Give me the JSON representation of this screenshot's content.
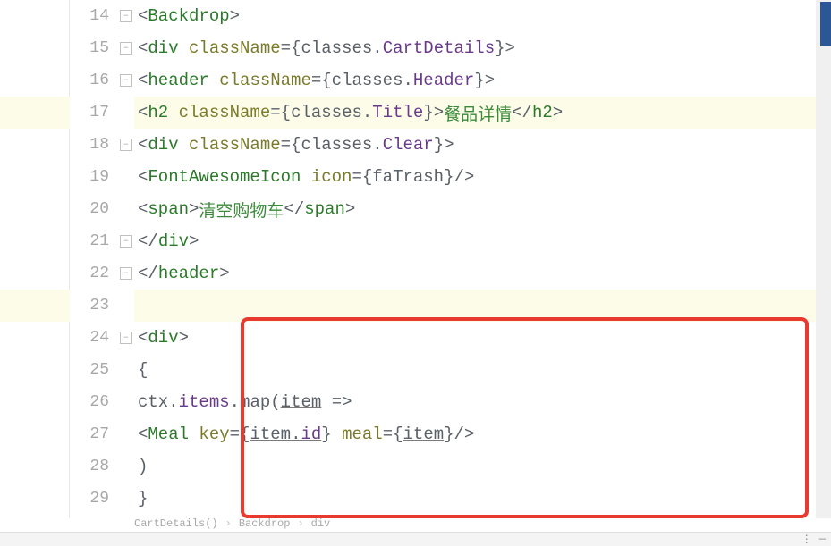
{
  "lines": [
    {
      "num": "14",
      "indent": 1,
      "tokens": [
        [
          "tag-bracket",
          "<"
        ],
        [
          "tag-name",
          "Backdrop"
        ],
        [
          "tag-bracket",
          ">"
        ]
      ],
      "fold": true
    },
    {
      "num": "15",
      "indent": 2,
      "tokens": [
        [
          "tag-bracket",
          "<"
        ],
        [
          "tag-name",
          "div "
        ],
        [
          "attr-name",
          "className"
        ],
        [
          "attr-eq",
          "="
        ],
        [
          "brace",
          "{"
        ],
        [
          "ident",
          "classes"
        ],
        [
          "op",
          "."
        ],
        [
          "prop",
          "CartDetails"
        ],
        [
          "brace",
          "}"
        ],
        [
          "tag-bracket",
          ">"
        ]
      ],
      "fold": true
    },
    {
      "num": "16",
      "indent": 3,
      "tokens": [
        [
          "tag-bracket",
          "<"
        ],
        [
          "tag-name",
          "header "
        ],
        [
          "attr-name",
          "className"
        ],
        [
          "attr-eq",
          "="
        ],
        [
          "brace",
          "{"
        ],
        [
          "ident",
          "classes"
        ],
        [
          "op",
          "."
        ],
        [
          "prop",
          "Header"
        ],
        [
          "brace",
          "}"
        ],
        [
          "tag-bracket",
          ">"
        ]
      ],
      "fold": true
    },
    {
      "num": "17",
      "indent": 4,
      "tokens": [
        [
          "tag-bracket",
          "<"
        ],
        [
          "tag-name",
          "h2 "
        ],
        [
          "attr-name",
          "className"
        ],
        [
          "attr-eq",
          "="
        ],
        [
          "brace",
          "{"
        ],
        [
          "ident",
          "classes"
        ],
        [
          "op",
          "."
        ],
        [
          "prop",
          "Title"
        ],
        [
          "brace",
          "}"
        ],
        [
          "tag-bracket",
          ">"
        ],
        [
          "text",
          "餐品详情"
        ],
        [
          "tag-bracket",
          "</"
        ],
        [
          "tag-name",
          "h2"
        ],
        [
          "tag-bracket",
          ">"
        ]
      ],
      "hl": true
    },
    {
      "num": "18",
      "indent": 4,
      "tokens": [
        [
          "tag-bracket",
          "<"
        ],
        [
          "tag-name",
          "div "
        ],
        [
          "attr-name",
          "className"
        ],
        [
          "attr-eq",
          "="
        ],
        [
          "brace",
          "{"
        ],
        [
          "ident",
          "classes"
        ],
        [
          "op",
          "."
        ],
        [
          "prop",
          "Clear"
        ],
        [
          "brace",
          "}"
        ],
        [
          "tag-bracket",
          ">"
        ]
      ],
      "fold": true
    },
    {
      "num": "19",
      "indent": 5,
      "tokens": [
        [
          "tag-bracket",
          "<"
        ],
        [
          "tag-name",
          "FontAwesomeIcon "
        ],
        [
          "attr-name",
          "icon"
        ],
        [
          "attr-eq",
          "="
        ],
        [
          "brace",
          "{"
        ],
        [
          "ident",
          "faTrash"
        ],
        [
          "brace",
          "}"
        ],
        [
          "tag-bracket",
          "/>"
        ]
      ]
    },
    {
      "num": "20",
      "indent": 5,
      "tokens": [
        [
          "tag-bracket",
          "<"
        ],
        [
          "tag-name",
          "span"
        ],
        [
          "tag-bracket",
          ">"
        ],
        [
          "text",
          "清空购物车"
        ],
        [
          "tag-bracket",
          "</"
        ],
        [
          "tag-name",
          "span"
        ],
        [
          "tag-bracket",
          ">"
        ]
      ]
    },
    {
      "num": "21",
      "indent": 4,
      "tokens": [
        [
          "tag-bracket",
          "</"
        ],
        [
          "tag-name",
          "div"
        ],
        [
          "tag-bracket",
          ">"
        ]
      ],
      "foldclose": true
    },
    {
      "num": "22",
      "indent": 3,
      "tokens": [
        [
          "tag-bracket",
          "</"
        ],
        [
          "tag-name",
          "header"
        ],
        [
          "tag-bracket",
          ">"
        ]
      ],
      "foldclose": true
    },
    {
      "num": "23",
      "indent": 0,
      "tokens": [],
      "hl": true
    },
    {
      "num": "24",
      "indent": 3,
      "tokens": [
        [
          "tag-bracket",
          "<"
        ],
        [
          "tag-name",
          "div"
        ],
        [
          "tag-bracket",
          ">"
        ]
      ],
      "fold": true
    },
    {
      "num": "25",
      "indent": 4,
      "tokens": [
        [
          "brace",
          "{"
        ]
      ]
    },
    {
      "num": "26",
      "indent": 5,
      "tokens": [
        [
          "ident",
          "ctx"
        ],
        [
          "op",
          "."
        ],
        [
          "prop",
          "items"
        ],
        [
          "op",
          "."
        ],
        [
          "ident",
          "map"
        ],
        [
          "op",
          "("
        ],
        [
          "ident underline",
          "item"
        ],
        [
          "ident",
          " "
        ],
        [
          "op",
          "=>"
        ]
      ]
    },
    {
      "num": "27",
      "indent": 6,
      "tokens": [
        [
          "tag-bracket",
          "<"
        ],
        [
          "tag-name",
          "Meal "
        ],
        [
          "attr-name",
          "key"
        ],
        [
          "attr-eq",
          "="
        ],
        [
          "brace",
          "{"
        ],
        [
          "ident underline",
          "item"
        ],
        [
          "op underline",
          "."
        ],
        [
          "prop underline",
          "id"
        ],
        [
          "brace",
          "}"
        ],
        [
          "ident",
          " "
        ],
        [
          "attr-name",
          "meal"
        ],
        [
          "attr-eq",
          "="
        ],
        [
          "brace",
          "{"
        ],
        [
          "ident underline",
          "item"
        ],
        [
          "brace",
          "}"
        ],
        [
          "tag-bracket",
          "/>"
        ]
      ]
    },
    {
      "num": "28",
      "indent": 5,
      "tokens": [
        [
          "op",
          ")"
        ]
      ]
    },
    {
      "num": "29",
      "indent": 4,
      "tokens": [
        [
          "brace",
          "}"
        ]
      ]
    }
  ],
  "breadcrumb": {
    "parts": [
      "CartDetails()",
      "Backdrop",
      "div"
    ]
  },
  "indent_unit": "    "
}
